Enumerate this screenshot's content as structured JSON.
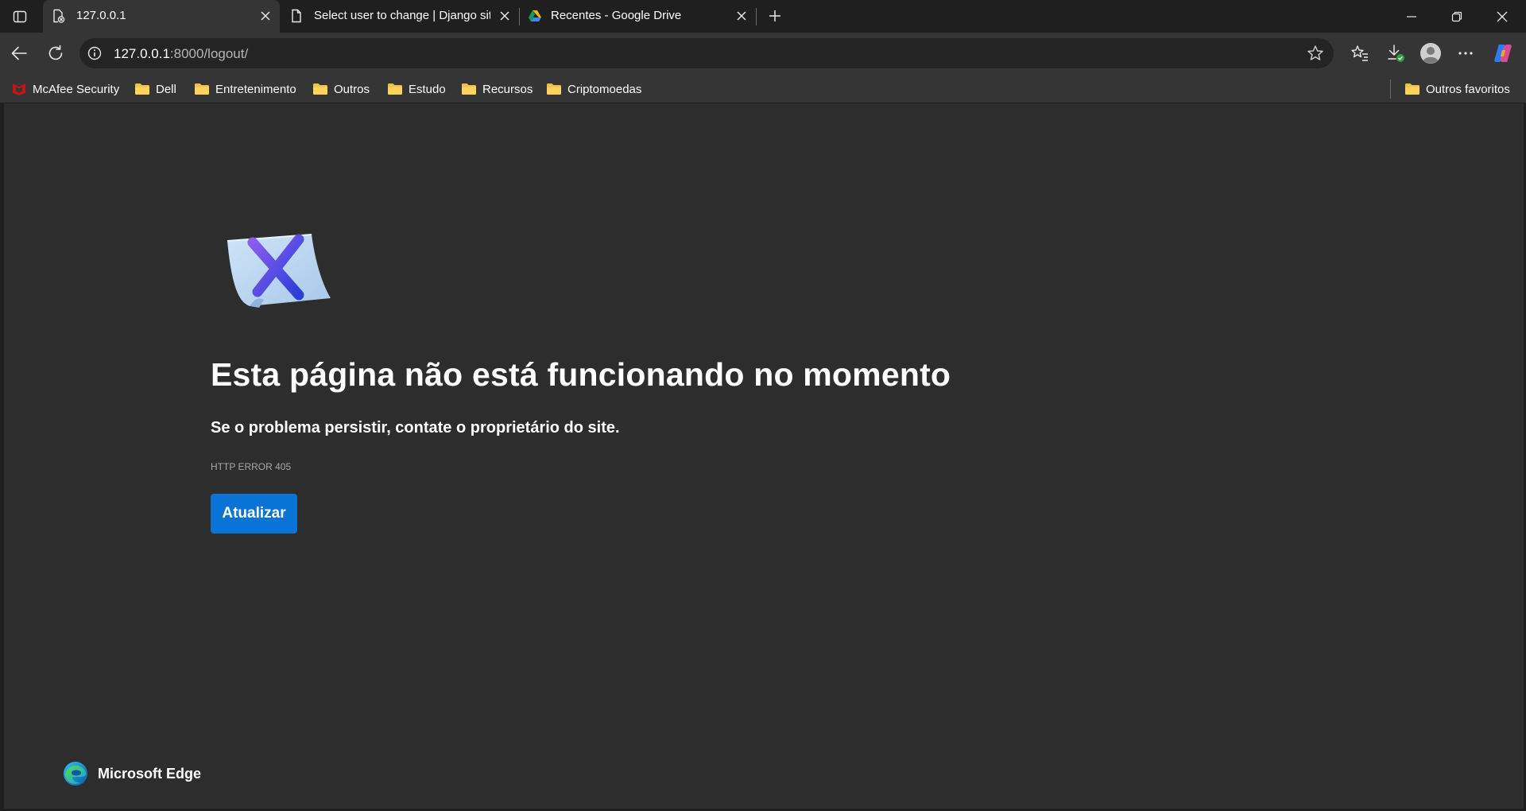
{
  "tabs": [
    {
      "title": "127.0.0.1",
      "icon": "broken-page-icon",
      "active": true
    },
    {
      "title": "Select user to change | Django site admin",
      "icon": "document-icon",
      "active": false
    },
    {
      "title": "Recentes - Google Drive",
      "icon": "google-drive-icon",
      "active": false
    }
  ],
  "address_bar": {
    "url_host": "127.0.0.1",
    "url_rest": ":8000/logout/"
  },
  "favorites": [
    {
      "label": "McAfee Security",
      "icon": "mcafee-icon"
    },
    {
      "label": "Dell",
      "icon": "folder-icon"
    },
    {
      "label": "Entretenimento",
      "icon": "folder-icon"
    },
    {
      "label": "Outros",
      "icon": "folder-icon"
    },
    {
      "label": "Estudo",
      "icon": "folder-icon"
    },
    {
      "label": "Recursos",
      "icon": "folder-icon"
    },
    {
      "label": "Criptomoedas",
      "icon": "folder-icon"
    }
  ],
  "other_favorites": "Outros favoritos",
  "error_page": {
    "title": "Esta página não está funcionando no momento",
    "subtitle": "Se o problema persistir, contate o proprietário do site.",
    "error_code": "HTTP ERROR 405",
    "reload_label": "Atualizar",
    "brand": "Microsoft Edge"
  },
  "colors": {
    "accent_button": "#0a74d6",
    "page_background": "#2d2d2d",
    "toolbar_background": "#353535",
    "tabstrip_background": "#1f1f1f"
  }
}
